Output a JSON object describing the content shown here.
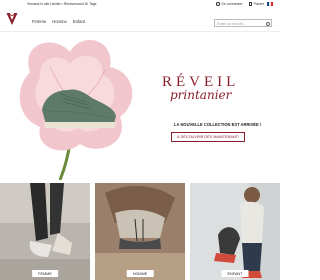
{
  "topbar": {
    "shipping_text": "Versand in alle Länder • Rückversand 30 Tage",
    "account_label": "Se connecter",
    "cart_label": "Panier",
    "flag_colors": [
      "#1f3f8f",
      "#ffffff",
      "#d42a2a"
    ]
  },
  "header": {
    "logo_icon": "v-logo-icon",
    "nav": [
      "Femme",
      "Homme",
      "Enfant"
    ],
    "search_placeholder": "Entrez un mot-clé..."
  },
  "hero": {
    "title_line1": "RÉVEIL",
    "title_line2": "printanier",
    "subtitle": "LA NOUVELLE COLLECTION EST ARRIVÉE !",
    "cta": "À DÉCOUVRIR DÈS MAINTENANT!",
    "accent": "#8a1e2a"
  },
  "tiles": [
    {
      "label": "FEMME"
    },
    {
      "label": "HOMME"
    },
    {
      "label": "ENFANT"
    }
  ]
}
